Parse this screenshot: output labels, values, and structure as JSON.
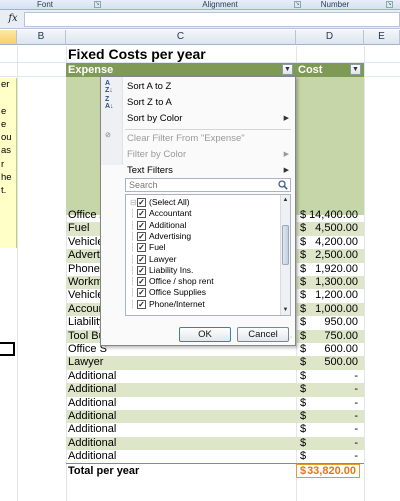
{
  "ribbon": {
    "groups": [
      "Font",
      "Alignment",
      "Number"
    ]
  },
  "formula_bar": {
    "fx_label": "fx",
    "value": ""
  },
  "columns": [
    "B",
    "C",
    "D",
    "E"
  ],
  "note": {
    "lines": [
      "er",
      "",
      "e",
      "e",
      "ou",
      "as",
      "r",
      "he",
      "t."
    ]
  },
  "sheet": {
    "title": "Fixed Costs per year",
    "header": {
      "expense": "Expense",
      "cost": "Cost"
    },
    "rows": [
      {
        "label": "Office /",
        "cur": "$",
        "amount": "14,400.00"
      },
      {
        "label": "Fuel",
        "cur": "$",
        "amount": "4,500.00"
      },
      {
        "label": "Vehicle",
        "cur": "$",
        "amount": "4,200.00"
      },
      {
        "label": "Advertis",
        "cur": "$",
        "amount": "2,500.00"
      },
      {
        "label": "Phone/I",
        "cur": "$",
        "amount": "1,920.00"
      },
      {
        "label": "Workm",
        "cur": "$",
        "amount": "1,300.00"
      },
      {
        "label": "Vehicle",
        "cur": "$",
        "amount": "1,200.00"
      },
      {
        "label": "Accoun",
        "cur": "$",
        "amount": "1,000.00"
      },
      {
        "label": "Liability",
        "cur": "$",
        "amount": "950.00"
      },
      {
        "label": "Tool Bu",
        "cur": "$",
        "amount": "750.00"
      },
      {
        "label": "Office S",
        "cur": "$",
        "amount": "600.00"
      },
      {
        "label": "Lawyer",
        "cur": "$",
        "amount": "500.00"
      },
      {
        "label": "Additional",
        "cur": "$",
        "amount": "-"
      },
      {
        "label": "Additional",
        "cur": "$",
        "amount": "-"
      },
      {
        "label": "Additional",
        "cur": "$",
        "amount": "-"
      },
      {
        "label": "Additional",
        "cur": "$",
        "amount": "-"
      },
      {
        "label": "Additional",
        "cur": "$",
        "amount": "-"
      },
      {
        "label": "Additional",
        "cur": "$",
        "amount": "-"
      },
      {
        "label": "Additional",
        "cur": "$",
        "amount": "-"
      }
    ],
    "total": {
      "label": "Total per year",
      "cur": "$",
      "amount": "33,820.00"
    }
  },
  "filter_menu": {
    "sort_az": "Sort A to Z",
    "sort_za": "Sort Z to A",
    "sort_by_color": "Sort by Color",
    "clear_filter": "Clear Filter From \"Expense\"",
    "filter_by_color": "Filter by Color",
    "text_filters": "Text Filters",
    "search_placeholder": "Search",
    "items": [
      {
        "label": "(Select All)",
        "checked": true
      },
      {
        "label": "Accountant",
        "checked": true
      },
      {
        "label": "Additional",
        "checked": true
      },
      {
        "label": "Advertising",
        "checked": true
      },
      {
        "label": "Fuel",
        "checked": true
      },
      {
        "label": "Lawyer",
        "checked": true
      },
      {
        "label": "Liability Ins.",
        "checked": true
      },
      {
        "label": "Office / shop rent",
        "checked": true
      },
      {
        "label": "Office Supplies",
        "checked": true
      },
      {
        "label": "Phone/Internet",
        "checked": true
      }
    ],
    "ok_label": "OK",
    "cancel_label": "Cancel"
  }
}
